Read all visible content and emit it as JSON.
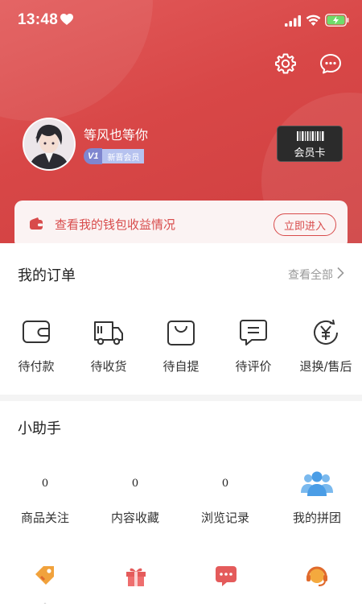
{
  "status_bar": {
    "time": "13:48"
  },
  "profile": {
    "username": "等风也等你",
    "level_badge": "V1",
    "level_name": "新晋会员",
    "vip_card_label": "会员卡"
  },
  "wallet": {
    "text": "查看我的钱包收益情况",
    "button": "立即进入"
  },
  "orders": {
    "title": "我的订单",
    "view_all": "查看全部",
    "items": [
      {
        "label": "待付款",
        "icon": "wallet-icon"
      },
      {
        "label": "待收货",
        "icon": "truck-icon"
      },
      {
        "label": "待自提",
        "icon": "bag-icon"
      },
      {
        "label": "待评价",
        "icon": "comment-icon"
      },
      {
        "label": "退换/售后",
        "icon": "yen-refund-icon"
      }
    ]
  },
  "assistant": {
    "title": "小助手",
    "stats": [
      {
        "value": "0",
        "label": "商品关注"
      },
      {
        "value": "0",
        "label": "内容收藏"
      },
      {
        "value": "0",
        "label": "浏览记录"
      },
      {
        "value": "",
        "label": "我的拼团",
        "icon": "group-icon"
      }
    ],
    "tools": [
      "coupon-tag-icon",
      "gift-icon",
      "chat-bubble-icon",
      "customer-service-icon"
    ]
  },
  "colors": {
    "header_red": "#d84747",
    "accent_red": "#d84b4b",
    "group_icon_blue": "#5aa8ea",
    "coupon_orange": "#f1a23c"
  }
}
